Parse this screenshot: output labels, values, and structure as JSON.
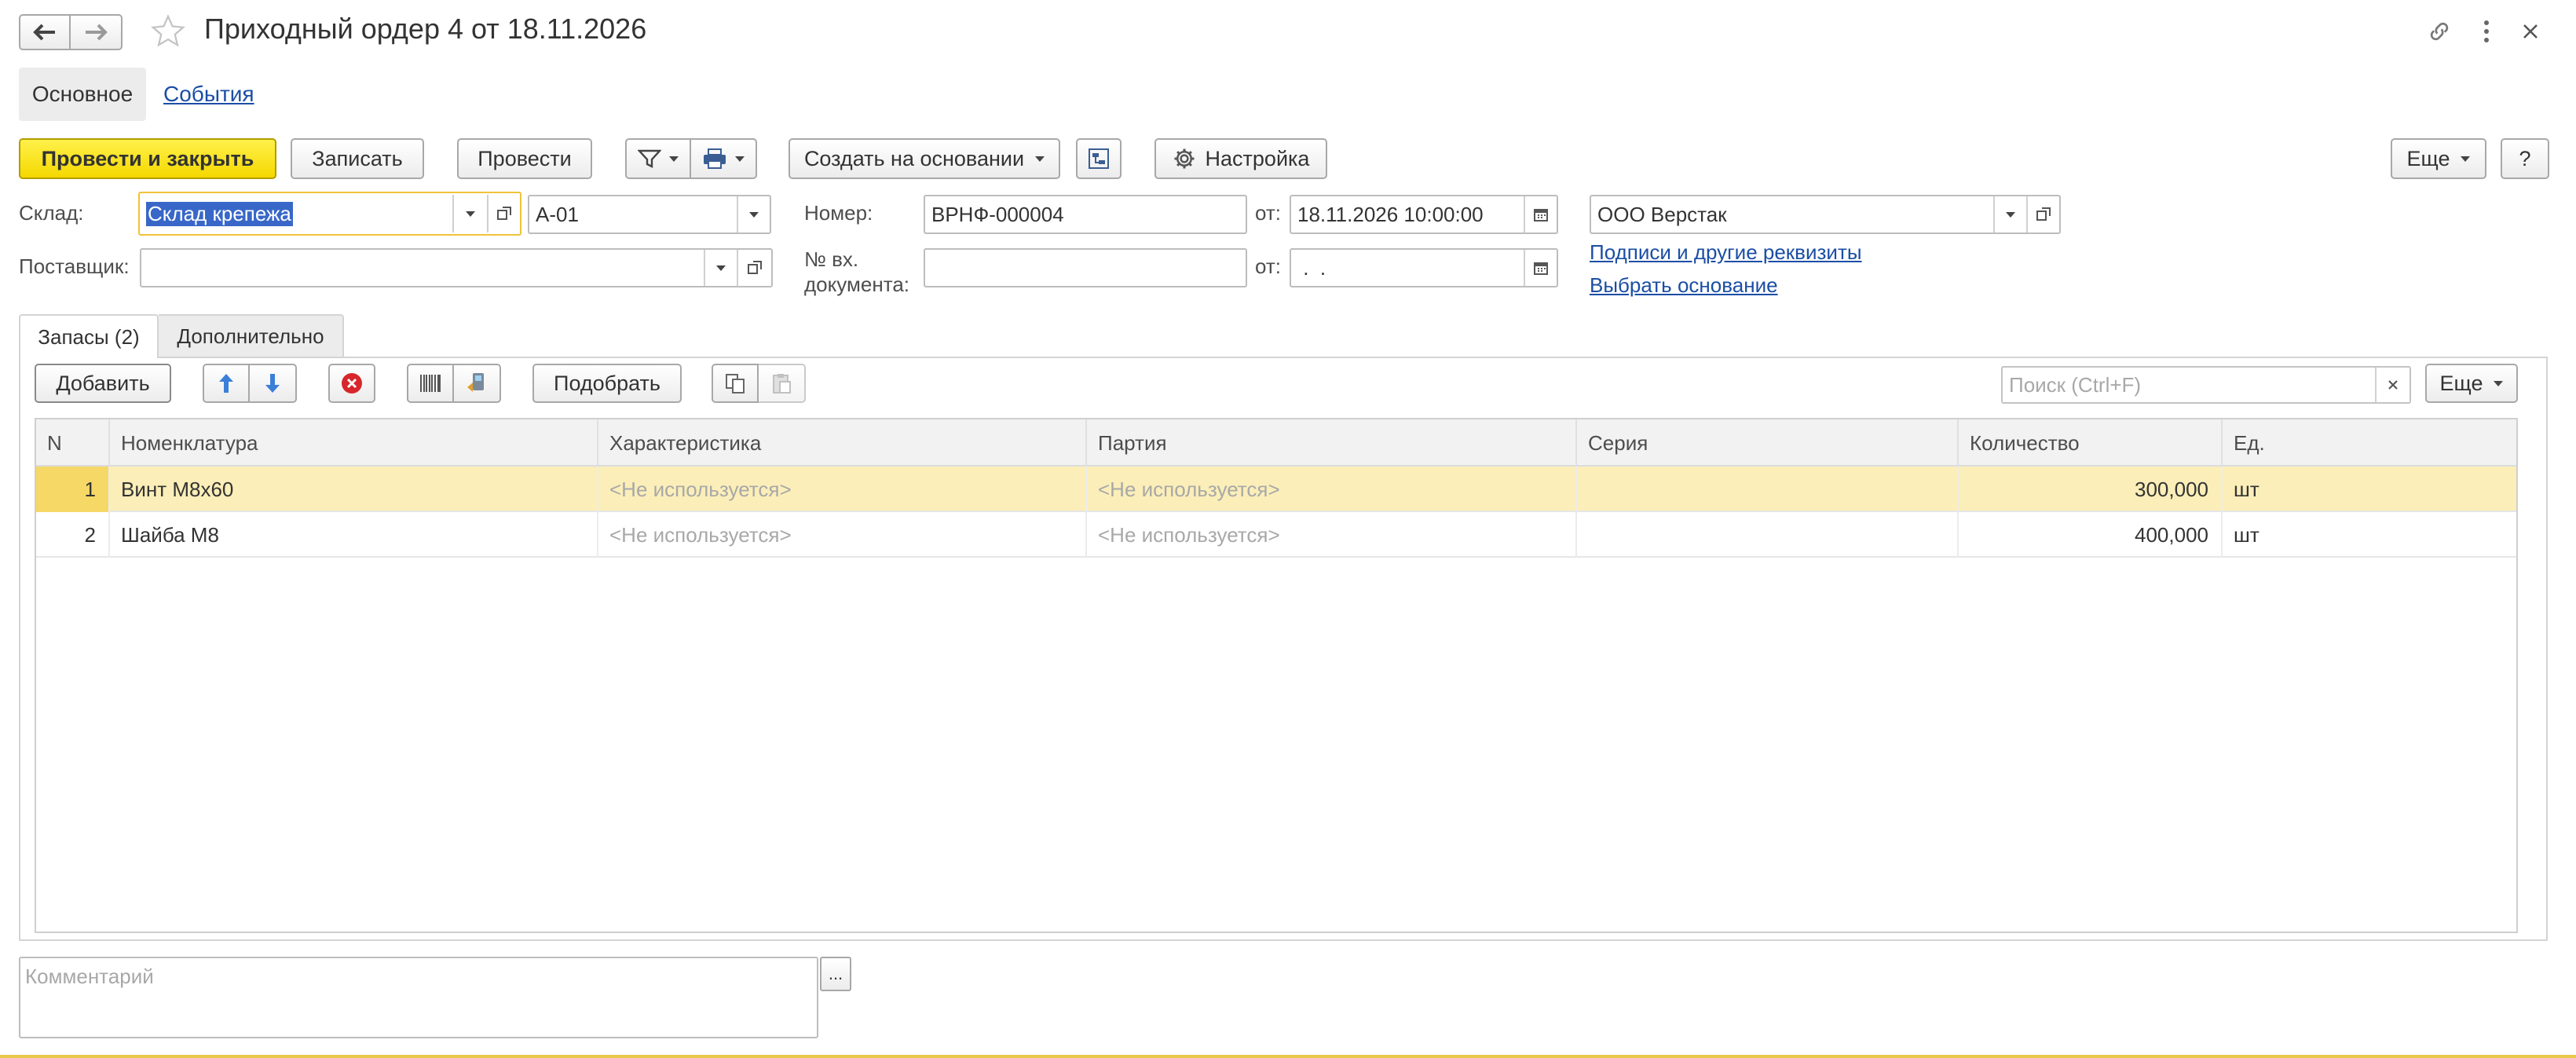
{
  "window": {
    "title": "Приходный ордер 4 от 18.11.2026",
    "icons": [
      "back-arrow-icon",
      "forward-arrow-icon",
      "star-icon",
      "link-icon",
      "more-vertical-icon",
      "close-icon"
    ]
  },
  "nav_tabs": [
    {
      "label": "Основное",
      "active": true
    },
    {
      "label": "События",
      "active": false
    }
  ],
  "toolbar": {
    "post_close": "Провести и закрыть",
    "save": "Записать",
    "post": "Провести",
    "create_based": "Создать на основании",
    "settings": "Настройка",
    "more": "Еще",
    "help": "?"
  },
  "form": {
    "warehouse_label": "Склад:",
    "warehouse_value": "Склад крепежа",
    "cell_value": "А-01",
    "supplier_label": "Поставщик:",
    "supplier_value": "",
    "number_label": "Номер:",
    "number_value": "ВРНФ-000004",
    "from_label": "от:",
    "date_value": "18.11.2026 10:00:00",
    "incoming_doc_label_1": "№ вх.",
    "incoming_doc_label_2": "документа:",
    "incoming_doc_value": "",
    "from_label_2": "от:",
    "incoming_date_value": " .  .",
    "organization_value": "ООО Верстак",
    "signatures_link": "Подписи и другие реквизиты",
    "choose_basis_link": "Выбрать основание"
  },
  "inner_tabs": [
    {
      "label": "Запасы (2)",
      "active": true
    },
    {
      "label": "Дополнительно",
      "active": false
    }
  ],
  "table_toolbar": {
    "add": "Добавить",
    "pick": "Подобрать",
    "search_placeholder": "Поиск (Ctrl+F)",
    "more": "Еще"
  },
  "table": {
    "columns": [
      "N",
      "Номенклатура",
      "Характеристика",
      "Партия",
      "Серия",
      "Количество",
      "Ед."
    ],
    "rows": [
      {
        "n": "1",
        "item": "Винт М8х60",
        "characteristic": "<Не используется>",
        "batch": "<Не используется>",
        "series": "",
        "qty": "300,000",
        "unit": "шт",
        "selected": true
      },
      {
        "n": "2",
        "item": "Шайба М8",
        "characteristic": "<Не используется>",
        "batch": "<Не используется>",
        "series": "",
        "qty": "400,000",
        "unit": "шт",
        "selected": false
      }
    ]
  },
  "comment": {
    "placeholder": "Комментарий",
    "button": "..."
  },
  "colors": {
    "accent_yellow": "#f5d800",
    "selected_row": "#fbeeb8",
    "link": "#1b4ea5"
  }
}
